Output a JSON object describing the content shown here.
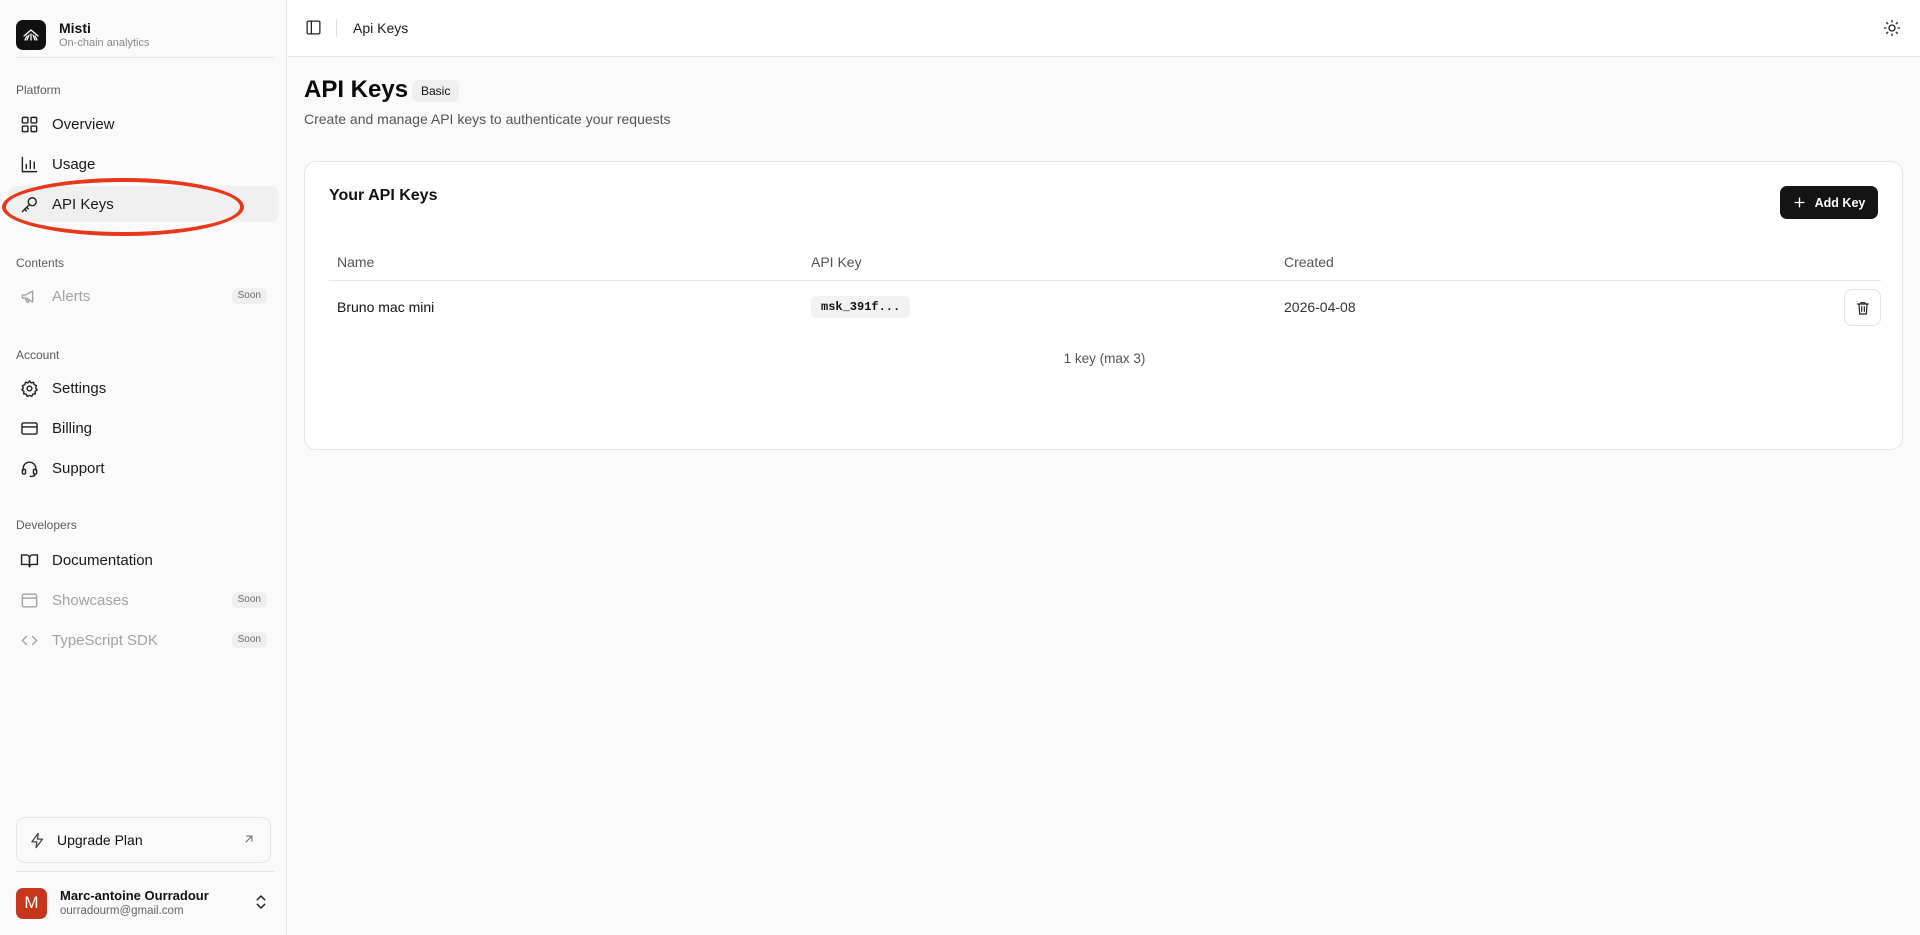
{
  "brand": {
    "name": "Misti",
    "tagline": "On-chain analytics"
  },
  "sidebar": {
    "groups": {
      "platform": "Platform",
      "contents": "Contents",
      "account": "Account",
      "developers": "Developers"
    },
    "items": {
      "overview": "Overview",
      "usage": "Usage",
      "api_keys": "API Keys",
      "alerts": "Alerts",
      "settings": "Settings",
      "billing": "Billing",
      "support": "Support",
      "documentation": "Documentation",
      "showcases": "Showcases",
      "typescript_sdk": "TypeScript SDK"
    },
    "soon_badge": "Soon",
    "active_item": "api_keys",
    "upgrade_label": "Upgrade Plan"
  },
  "user": {
    "initial": "M",
    "name": "Marc-antoine Ourradour",
    "email": "ourradourm@gmail.com"
  },
  "topbar": {
    "breadcrumb": "Api Keys"
  },
  "page": {
    "title": "API Keys",
    "plan_badge": "Basic",
    "subtitle": "Create and manage API keys to authenticate your requests"
  },
  "card": {
    "title": "Your API Keys",
    "add_button": "Add Key",
    "columns": {
      "name": "Name",
      "api_key": "API Key",
      "created": "Created"
    },
    "rows": [
      {
        "name": "Bruno mac mini",
        "api_key": "msk_391f...",
        "created": "2026-04-08"
      }
    ],
    "count_text": "1 key (max 3)"
  },
  "colors": {
    "highlight_ring": "#e8371b",
    "primary_button": "#141414",
    "avatar": "#c6361c"
  },
  "icons": [
    "brand-logo-icon",
    "layout-grid-icon",
    "bar-chart-icon",
    "key-icon",
    "megaphone-icon",
    "gear-icon",
    "credit-card-icon",
    "headset-icon",
    "book-open-icon",
    "browser-window-icon",
    "code-icon",
    "lightning-icon",
    "arrow-up-right-icon",
    "chevrons-up-down-icon",
    "sidebar-toggle-icon",
    "sun-icon",
    "plus-icon",
    "trash-icon"
  ]
}
